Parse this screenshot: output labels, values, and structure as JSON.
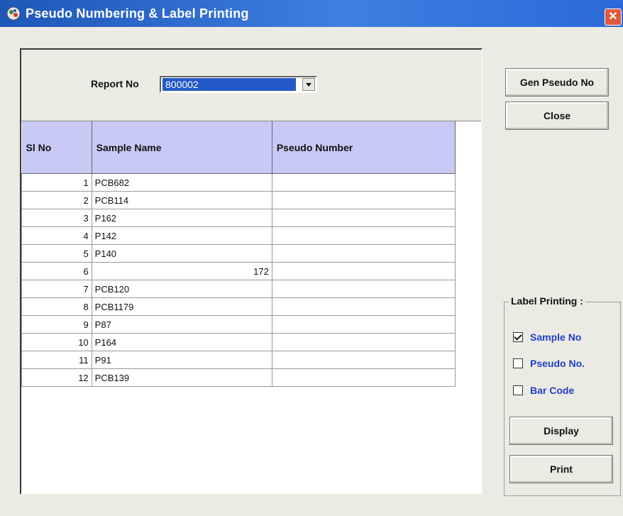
{
  "window": {
    "title": "Pseudo Numbering & Label Printing",
    "close_glyph": "✕"
  },
  "report": {
    "label": "Report No",
    "value": "800002"
  },
  "table": {
    "headers": [
      "Sl No",
      "Sample Name",
      "Pseudo Number"
    ],
    "rows": [
      {
        "sl": "1",
        "name": "PCB682",
        "pseudo": ""
      },
      {
        "sl": "2",
        "name": "PCB114",
        "pseudo": ""
      },
      {
        "sl": "3",
        "name": "P162",
        "pseudo": ""
      },
      {
        "sl": "4",
        "name": "P142",
        "pseudo": ""
      },
      {
        "sl": "5",
        "name": "P140",
        "pseudo": ""
      },
      {
        "sl": "6",
        "name": "172",
        "pseudo": ""
      },
      {
        "sl": "7",
        "name": "PCB120",
        "pseudo": ""
      },
      {
        "sl": "8",
        "name": "PCB1179",
        "pseudo": ""
      },
      {
        "sl": "9",
        "name": "P87",
        "pseudo": ""
      },
      {
        "sl": "10",
        "name": "P164",
        "pseudo": ""
      },
      {
        "sl": "11",
        "name": "P91",
        "pseudo": ""
      },
      {
        "sl": "12",
        "name": "PCB139",
        "pseudo": ""
      }
    ]
  },
  "buttons": {
    "gen_pseudo": "Gen Pseudo No",
    "close": "Close",
    "display": "Display",
    "print": "Print"
  },
  "label_printing": {
    "title": "Label Printing :",
    "options": [
      {
        "label": "Sample No",
        "checked": true
      },
      {
        "label": "Pseudo No.",
        "checked": false
      },
      {
        "label": "Bar Code",
        "checked": false
      }
    ]
  }
}
